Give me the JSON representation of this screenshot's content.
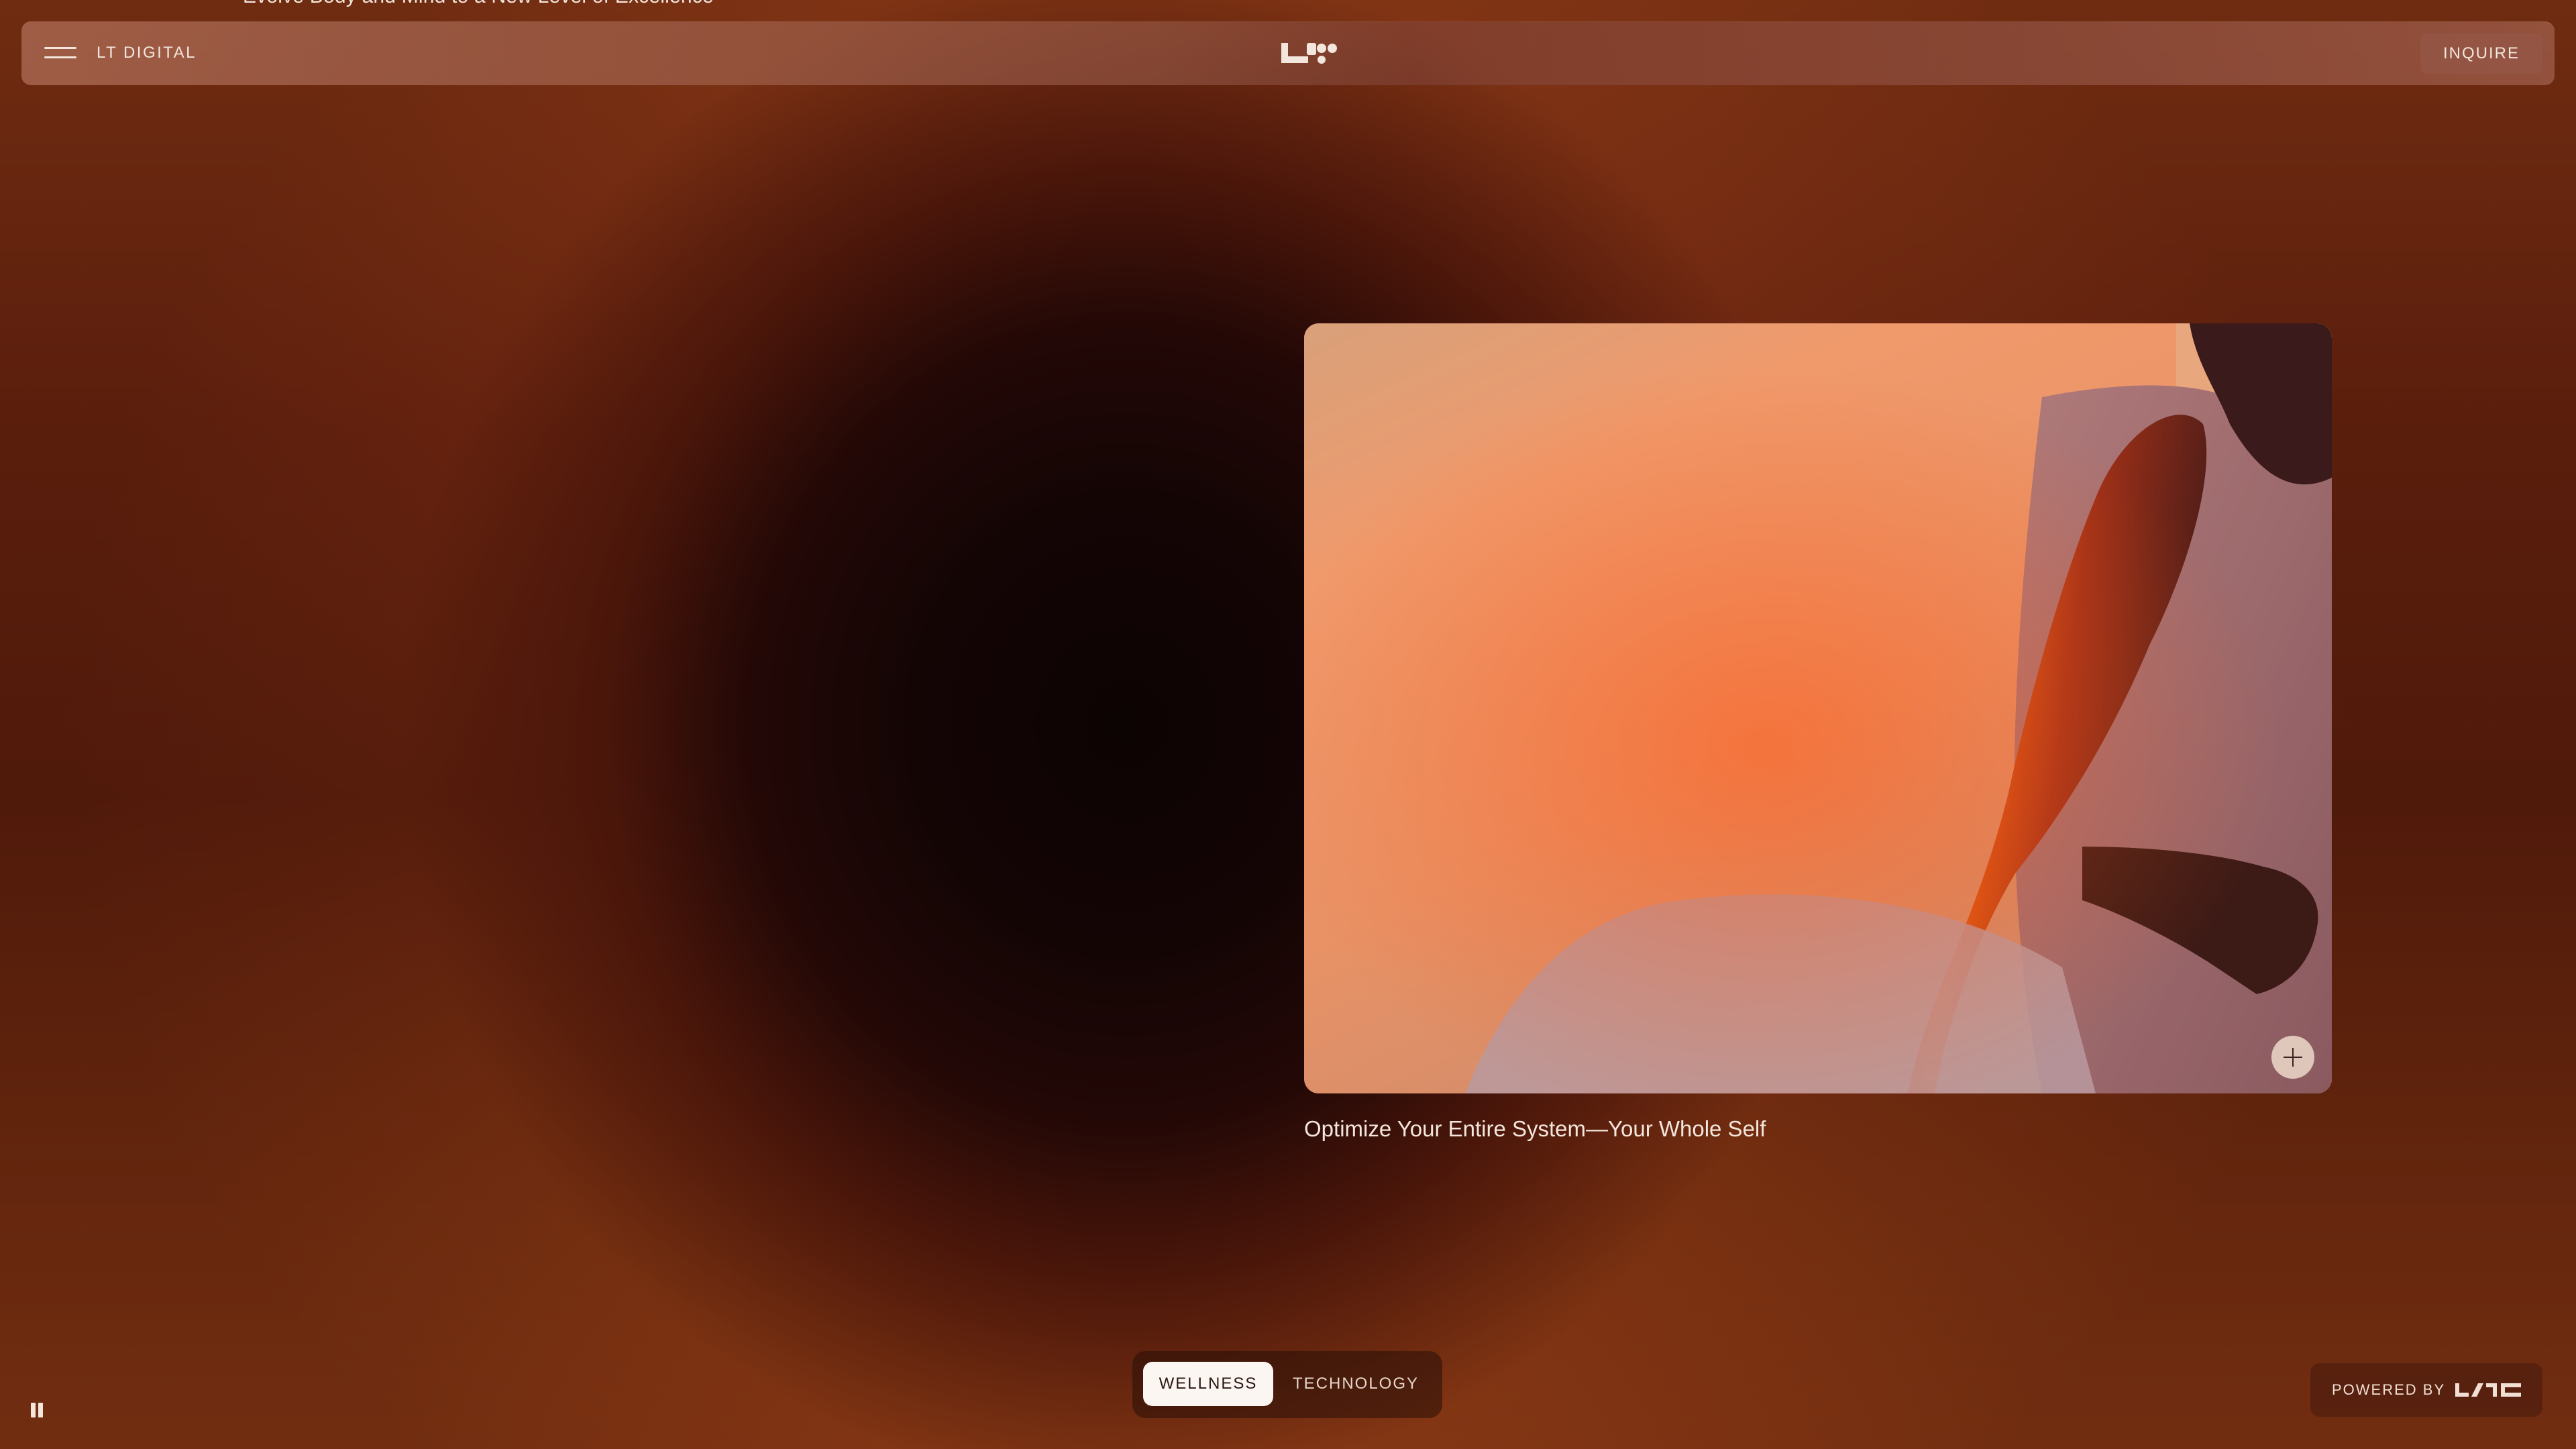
{
  "hero": {
    "scrolled_title": "Evolve Body and Mind to a New Level of Excellence"
  },
  "nav": {
    "brand_label": "LT DIGITAL",
    "logo_icon": "lt-logo-icon",
    "menu_icon": "hamburger-menu-icon",
    "inquire_label": "INQUIRE"
  },
  "card": {
    "image_description_icon": "runner-photo",
    "expand_icon": "plus-icon",
    "caption": "Optimize Your Entire System—Your Whole Self"
  },
  "segmented": {
    "options": [
      {
        "label": "WELLNESS",
        "selected": true
      },
      {
        "label": "TECHNOLOGY",
        "selected": false
      }
    ]
  },
  "playback": {
    "icon": "pause-icon"
  },
  "powered": {
    "label": "POWERED BY",
    "logo_icon": "ltc-logo-icon"
  },
  "colors": {
    "background_dark": "#0c0303",
    "background_warm": "#7a2a10",
    "text_light": "#f3e6dc",
    "active_pill": "#fbf6f2"
  }
}
